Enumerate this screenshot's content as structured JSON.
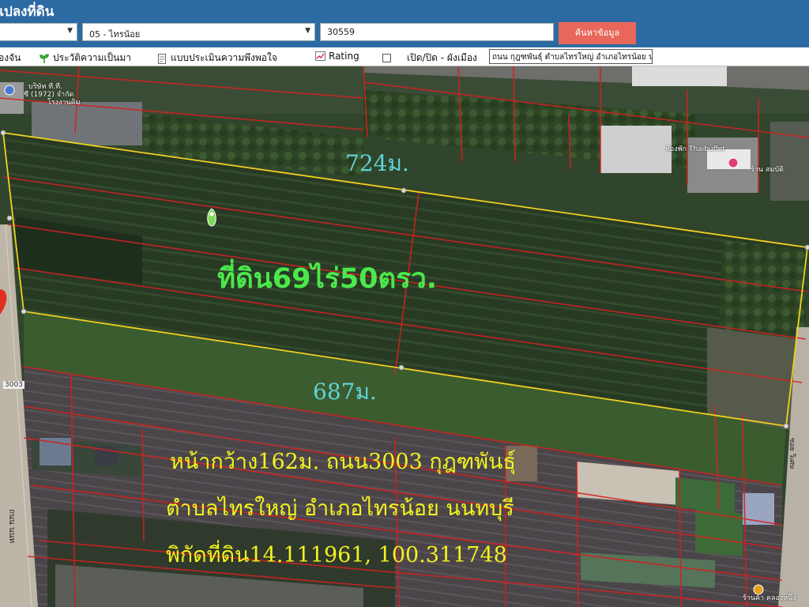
{
  "header": {
    "title": "แปลงที่ดิน",
    "district_select": "05 - ไทรน้อย",
    "parcel_number": "30559",
    "search_label": "ค้นหาข้อมูล"
  },
  "toolbar": {
    "items": [
      {
        "label": "องจัน",
        "icon": ""
      },
      {
        "label": "ประวัติความเป็นมา",
        "icon": "sprout-icon"
      },
      {
        "label": "แบบประเมินความพึงพอใจ",
        "icon": "document-icon"
      },
      {
        "label": "Rating",
        "icon": "chart-icon"
      },
      {
        "label": "เปิด/ปิด - ผังเมือง",
        "icon": "checkbox-icon"
      }
    ],
    "address": "ถนน กุฎฑพันธุ์ ตำบลไทรใหญ่ อำเภอไทรน้อย นนท"
  },
  "map": {
    "length_top": "724ม.",
    "length_bottom": "687ม.",
    "area": "ที่ดิน69ไร่50ตรว.",
    "info_line1": "หน้ากว้าง162ม. ถนน3003 กุฎฑพันธุ์",
    "info_line2": "ตำบลไทรใหญ่ อำเภอไทรน้อย นนทบุรี",
    "info_line3": "พิกัดที่ดิน14.111961, 100.311748",
    "poi_labels": {
      "company_line1": "บริษัท ที.ที.",
      "company_line2": "ซี (1972) จำกัด",
      "company_line3": "โรงงานคิม",
      "restaurant": "ห้องพัก Thaibuffet",
      "shop": "ร้าน สมบัติ",
      "shop_bottom": "ร้านค้า คลองหนึ่ง",
      "road_3003": "3003",
      "road_side": "ถนน นนท",
      "road_right": "ซอย วิเศษ"
    }
  },
  "colors": {
    "header_bg": "#2c6aa3",
    "search_btn": "#e8675a",
    "parcel_outline": "#f0d020",
    "parcel_lines": "#d42020",
    "area_text": "#4be84b",
    "length_text": "#5fd3d6",
    "info_text": "#f2f21e"
  }
}
